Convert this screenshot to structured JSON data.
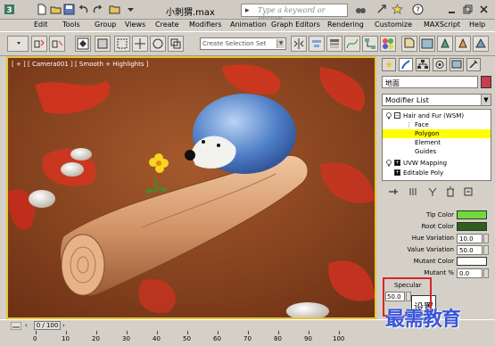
{
  "titlebar": {
    "title": "小刺猬.max",
    "search_placeholder": "Type a keyword or phrase"
  },
  "menu": [
    "Edit",
    "Tools",
    "Group",
    "Views",
    "Create",
    "Modifiers",
    "Animation",
    "Graph Editors",
    "Rendering",
    "Customize",
    "MAXScript",
    "Help"
  ],
  "toolbar": {
    "selection_set_placeholder": "Create Selection Set"
  },
  "viewport": {
    "label": "[ + ] [ Camera001 ] [ Smooth + Highlights ]"
  },
  "panel": {
    "object_name": "地面",
    "object_color": "#c93b4d",
    "modifier_list": "Modifier List",
    "stack": [
      {
        "label": "Hair and Fur (WSM)",
        "selected": false
      },
      {
        "label": "Face",
        "selected": false
      },
      {
        "label": "Polygon",
        "selected": true
      },
      {
        "label": "Element",
        "selected": false
      },
      {
        "label": "Guides",
        "selected": false
      },
      {
        "label": "UVW Mapping",
        "selected": false
      },
      {
        "label": "Editable Poly",
        "selected": false
      }
    ],
    "params": {
      "tip_color_label": "Tip Color",
      "tip_color": "#73d93b",
      "root_color_label": "Root Color",
      "root_color": "#2f5e1e",
      "hue_variation_label": "Hue Variation",
      "hue_variation": "10.0",
      "value_variation_label": "Value Variation",
      "value_variation": "50.0",
      "mutant_color_label": "Mutant Color",
      "mutant_color": "#ffffff",
      "mutant_pct_label": "Mutant %",
      "mutant_pct": "0.0",
      "specular_label": "Specular",
      "specular": "50.0",
      "set_button": "设置"
    }
  },
  "timeline": {
    "frame": "0 / 100",
    "ticks": [
      "0",
      "10",
      "20",
      "30",
      "40",
      "50",
      "60",
      "70",
      "80",
      "90",
      "100"
    ]
  },
  "watermark": "最需教育"
}
